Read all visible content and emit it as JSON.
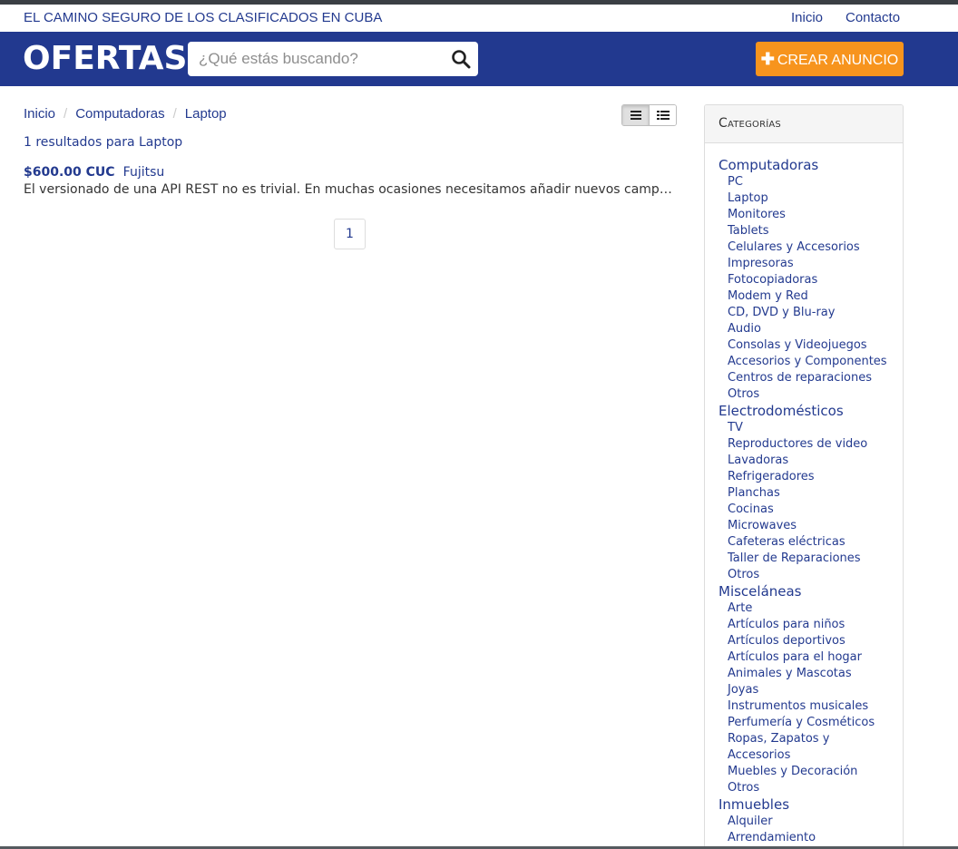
{
  "topbar": {
    "tagline": "EL CAMINO SEGURO DE LOS CLASIFICADOS EN CUBA",
    "nav": [
      "Inicio",
      "Contacto"
    ]
  },
  "header": {
    "logo": "OFERTAS",
    "search_placeholder": "¿Qué estás buscando?",
    "search_icon": "search-icon",
    "create_plus": "✚",
    "create_label": "CREAR ANUNCIO",
    "colors": {
      "header_bg": "#22398f",
      "create_button": "#f7941d"
    }
  },
  "breadcrumb": [
    "Inicio",
    "Computadoras",
    "Laptop"
  ],
  "view_toggle": {
    "icons": [
      "list-icon",
      "detail-list-icon"
    ],
    "active": 0
  },
  "results": {
    "count_text": "1 resultados para Laptop",
    "items": [
      {
        "price": "$600.00 CUC",
        "brand": "Fujitsu",
        "description": "El versionado de una API REST no es trivial. En muchas ocasiones necesitamos añadir nuevos campos, cambiar la estructura de los recursos o modificar el comportamiento de los endpoints"
      }
    ]
  },
  "pagination": {
    "current": "1"
  },
  "categories": {
    "heading": "Categorías",
    "groups": [
      {
        "title": "Computadoras",
        "items": [
          "PC",
          "Laptop",
          "Monitores",
          "Tablets",
          "Celulares y Accesorios",
          "Impresoras",
          "Fotocopiadoras",
          "Modem y Red",
          "CD, DVD y Blu-ray",
          "Audio",
          "Consolas y Videojuegos",
          "Accesorios y Componentes",
          "Centros de reparaciones",
          "Otros"
        ]
      },
      {
        "title": "Electrodomésticos",
        "items": [
          "TV",
          "Reproductores de video",
          "Lavadoras",
          "Refrigeradores",
          "Planchas",
          "Cocinas",
          "Microwaves",
          "Cafeteras eléctricas",
          "Taller de Reparaciones",
          "Otros"
        ]
      },
      {
        "title": "Misceláneas",
        "items": [
          "Arte",
          "Artículos para niños",
          "Artículos deportivos",
          "Artículos para el hogar",
          "Animales y Mascotas",
          "Joyas",
          "Instrumentos musicales",
          "Perfumería y Cosméticos",
          "Ropas, Zapatos y Accesorios",
          "Muebles y Decoración",
          "Otros"
        ]
      },
      {
        "title": "Inmuebles",
        "items": [
          "Alquiler",
          "Arrendamiento"
        ]
      }
    ]
  }
}
